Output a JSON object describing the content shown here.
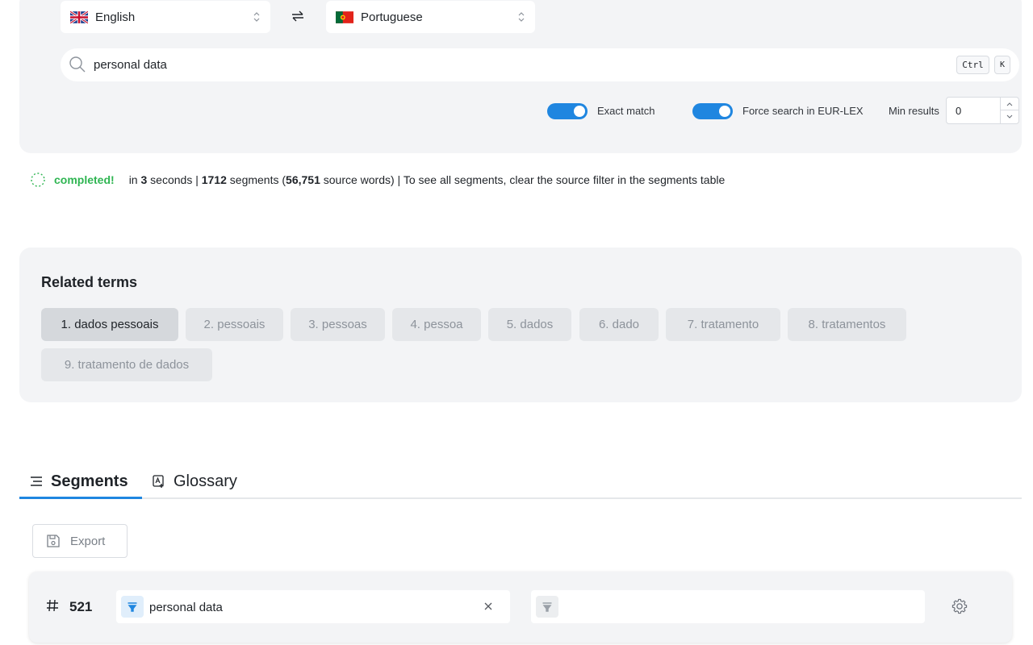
{
  "language_bar": {
    "source_language": "English",
    "target_language": "Portuguese",
    "source_flag": "uk-flag-icon",
    "target_flag": "portugal-flag-icon",
    "swap_icon": "swap-arrows-icon"
  },
  "search": {
    "query": "personal data",
    "icon": "search-icon",
    "shortcut_keys": [
      "Ctrl",
      "K"
    ]
  },
  "options": {
    "exact_match": {
      "label": "Exact match",
      "enabled": true
    },
    "force_eurlex": {
      "label": "Force search in EUR-LEX",
      "enabled": true
    },
    "min_results": {
      "label": "Min results",
      "value": "0"
    }
  },
  "status": {
    "state": "completed!",
    "text_in": "in",
    "seconds": "3",
    "text_seconds": "seconds |",
    "segments": "1712",
    "text_segments": "segments (",
    "source_words": "56,751",
    "text_tail": "source words) | To see all segments, clear the source filter in the segments table"
  },
  "related_terms": {
    "title": "Related terms",
    "items": [
      "1. dados pessoais",
      "2. pessoais",
      "3. pessoas",
      "4. pessoa",
      "5. dados",
      "6. dado",
      "7. tratamento",
      "8. tratamentos",
      "9. tratamento de dados"
    ],
    "active_index": 0
  },
  "tabs": [
    {
      "label": "Segments",
      "icon": "lines-icon",
      "active": true
    },
    {
      "label": "Glossary",
      "icon": "glossary-icon",
      "active": false
    }
  ],
  "export": {
    "label": "Export",
    "icon": "save-icon"
  },
  "segment": {
    "hash_icon": "hash-icon",
    "number": "521",
    "source_filter_value": "personal data",
    "target_filter_value": "",
    "settings_icon": "gear-icon"
  },
  "colors": {
    "accent": "#1f86e0",
    "success": "#2fb552",
    "panel": "#f3f4f6",
    "chip": "#e5e7ea",
    "chip_active": "#d5d8dc"
  }
}
